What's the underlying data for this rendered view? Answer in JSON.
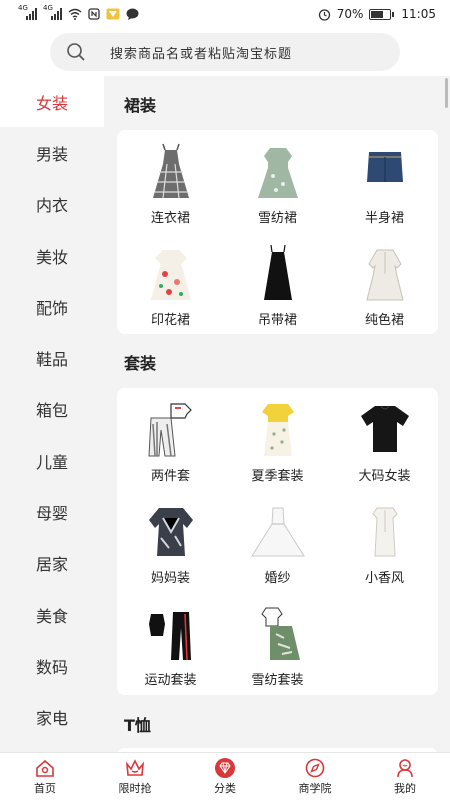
{
  "status": {
    "net_label_1": "4G",
    "net_label_2": "4G",
    "battery": "70%",
    "time": "11:05",
    "battery_level": 0.7
  },
  "search": {
    "placeholder": "搜索商品名或者粘贴淘宝标题"
  },
  "sidebar": {
    "items": [
      {
        "label": "女装"
      },
      {
        "label": "男装"
      },
      {
        "label": "内衣"
      },
      {
        "label": "美妆"
      },
      {
        "label": "配饰"
      },
      {
        "label": "鞋品"
      },
      {
        "label": "箱包"
      },
      {
        "label": "儿童"
      },
      {
        "label": "母婴"
      },
      {
        "label": "居家"
      },
      {
        "label": "美食"
      },
      {
        "label": "数码"
      },
      {
        "label": "家电"
      }
    ],
    "active_index": 0
  },
  "sections": [
    {
      "title": "裙装",
      "items": [
        {
          "label": "连衣裙",
          "icon": "plaid-dress-icon"
        },
        {
          "label": "雪纺裙",
          "icon": "chiffon-dress-icon"
        },
        {
          "label": "半身裙",
          "icon": "denim-skirt-icon"
        },
        {
          "label": "印花裙",
          "icon": "print-dress-icon"
        },
        {
          "label": "吊带裙",
          "icon": "slip-dress-icon"
        },
        {
          "label": "纯色裙",
          "icon": "solid-dress-icon"
        }
      ]
    },
    {
      "title": "套装",
      "items": [
        {
          "label": "两件套",
          "icon": "two-piece-icon"
        },
        {
          "label": "夏季套装",
          "icon": "summer-set-icon"
        },
        {
          "label": "大码女装",
          "icon": "plus-size-icon"
        },
        {
          "label": "妈妈装",
          "icon": "mom-wear-icon"
        },
        {
          "label": "婚纱",
          "icon": "wedding-dress-icon"
        },
        {
          "label": "小香风",
          "icon": "tweed-style-icon"
        },
        {
          "label": "运动套装",
          "icon": "sport-set-icon"
        },
        {
          "label": "雪纺套装",
          "icon": "chiffon-set-icon"
        }
      ]
    },
    {
      "title": "T恤"
    }
  ],
  "nav": {
    "items": [
      {
        "label": "首页",
        "icon": "home-icon"
      },
      {
        "label": "限时抢",
        "icon": "crown-icon"
      },
      {
        "label": "分类",
        "icon": "diamond-icon"
      },
      {
        "label": "商学院",
        "icon": "compass-icon"
      },
      {
        "label": "我的",
        "icon": "user-icon"
      }
    ],
    "active_index": 2
  },
  "colors": {
    "accent": "#d9383a",
    "background": "#f3f3f3",
    "card": "#ffffff"
  }
}
